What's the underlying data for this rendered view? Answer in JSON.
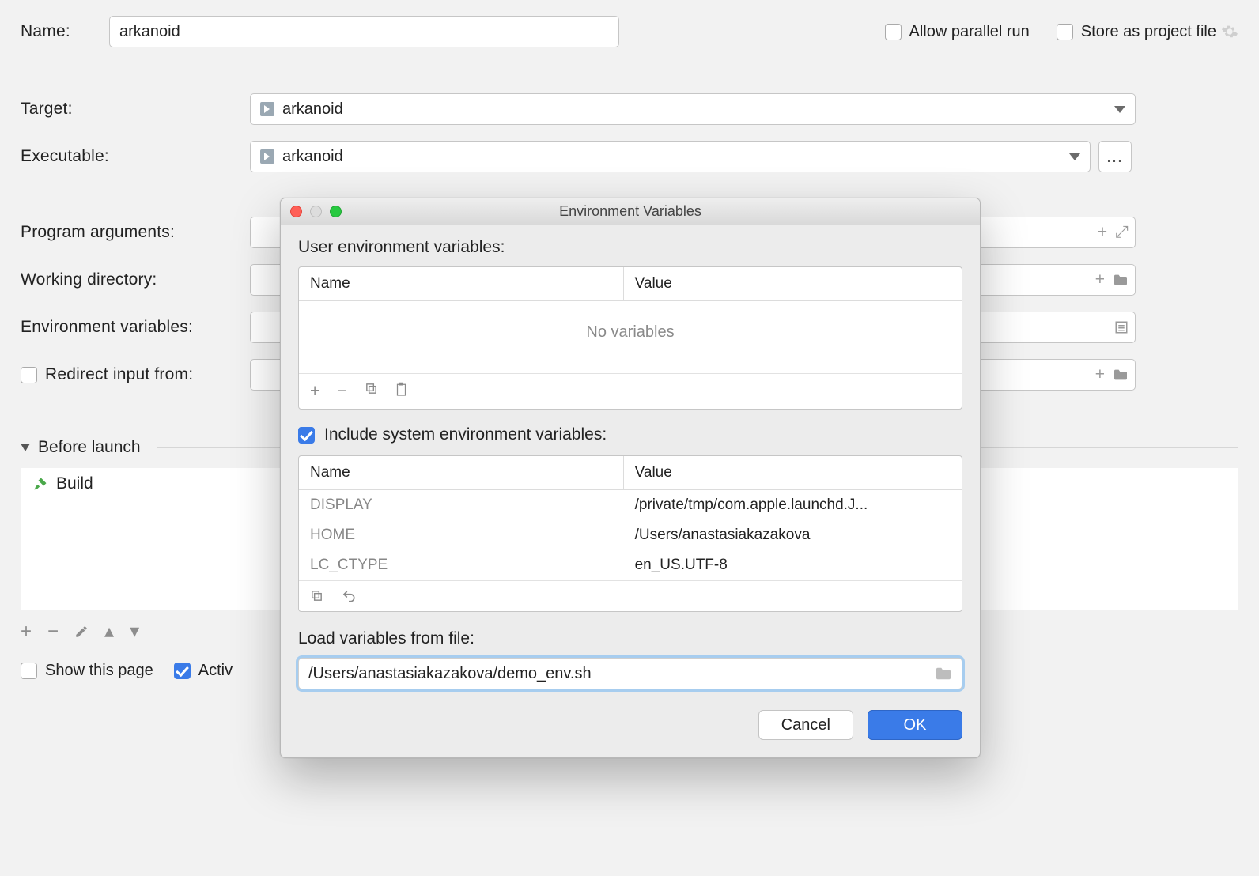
{
  "config": {
    "name_label": "Name:",
    "name_value": "arkanoid",
    "allow_parallel_label": "Allow parallel run",
    "allow_parallel_checked": false,
    "store_project_label": "Store as project file",
    "store_project_checked": false,
    "target_label": "Target:",
    "target_value": "arkanoid",
    "executable_label": "Executable:",
    "executable_value": "arkanoid",
    "program_args_label": "Program arguments:",
    "program_args_value": "",
    "working_dir_label": "Working directory:",
    "working_dir_value": "",
    "env_vars_label": "Environment variables:",
    "env_vars_value": "",
    "redirect_label": "Redirect input from:",
    "redirect_checked": false,
    "redirect_value": "",
    "before_launch_label": "Before launch",
    "before_launch_items": [
      "Build"
    ],
    "show_page_label": "Show this page",
    "show_page_checked": false,
    "activate_label": "Activ",
    "activate_checked": true
  },
  "dialog": {
    "title": "Environment Variables",
    "user_section_label": "User environment variables:",
    "col_name": "Name",
    "col_value": "Value",
    "no_variables": "No variables",
    "include_sys_label": "Include system environment variables:",
    "include_sys_checked": true,
    "sys_vars": [
      {
        "name": "DISPLAY",
        "value": "/private/tmp/com.apple.launchd.J..."
      },
      {
        "name": "HOME",
        "value": "/Users/anastasiakazakova"
      },
      {
        "name": "LC_CTYPE",
        "value": "en_US.UTF-8"
      }
    ],
    "load_file_label": "Load variables from file:",
    "load_file_value": "/Users/anastasiakazakova/demo_env.sh",
    "cancel_label": "Cancel",
    "ok_label": "OK"
  }
}
